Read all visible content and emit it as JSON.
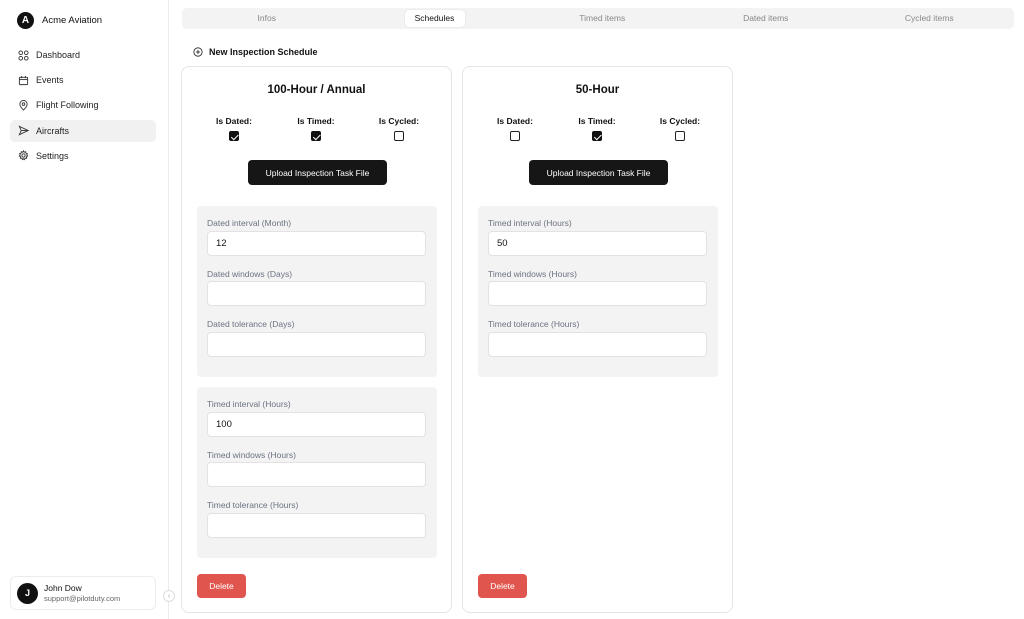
{
  "brand": {
    "logo_letter": "A",
    "name": "Acme Aviation"
  },
  "sidebar": {
    "items": [
      {
        "label": "Dashboard",
        "icon": "grid-icon"
      },
      {
        "label": "Events",
        "icon": "calendar-icon"
      },
      {
        "label": "Flight Following",
        "icon": "map-pin-icon"
      },
      {
        "label": "Aircrafts",
        "icon": "send-icon",
        "active": true
      },
      {
        "label": "Settings",
        "icon": "gear-icon"
      }
    ]
  },
  "user": {
    "initial": "J",
    "name": "John Dow",
    "email": "support@pilotduty.com"
  },
  "tabs": [
    "Infos",
    "Schedules",
    "Timed items",
    "Dated items",
    "Cycled items"
  ],
  "active_tab": "Schedules",
  "new_schedule_label": "New Inspection Schedule",
  "flag_labels": {
    "dated": "Is Dated:",
    "timed": "Is Timed:",
    "cycled": "Is Cycled:"
  },
  "upload_label": "Upload Inspection Task File",
  "delete_label": "Delete",
  "cards": [
    {
      "title": "100-Hour / Annual",
      "is_dated": true,
      "is_timed": true,
      "is_cycled": false,
      "groups": [
        {
          "fields": [
            {
              "label": "Dated interval (Month)",
              "value": "12"
            },
            {
              "label": "Dated windows (Days)",
              "value": ""
            },
            {
              "label": "Dated tolerance (Days)",
              "value": ""
            }
          ]
        },
        {
          "fields": [
            {
              "label": "Timed interval (Hours)",
              "value": "100"
            },
            {
              "label": "Timed windows (Hours)",
              "value": ""
            },
            {
              "label": "Timed tolerance (Hours)",
              "value": ""
            }
          ]
        }
      ]
    },
    {
      "title": "50-Hour",
      "is_dated": false,
      "is_timed": true,
      "is_cycled": false,
      "groups": [
        {
          "fields": [
            {
              "label": "Timed interval (Hours)",
              "value": "50"
            },
            {
              "label": "Timed windows (Hours)",
              "value": ""
            },
            {
              "label": "Timed tolerance (Hours)",
              "value": ""
            }
          ]
        }
      ]
    }
  ],
  "colors": {
    "primary": "#161616",
    "danger": "#e0564f",
    "panel": "#f3f3f4"
  }
}
